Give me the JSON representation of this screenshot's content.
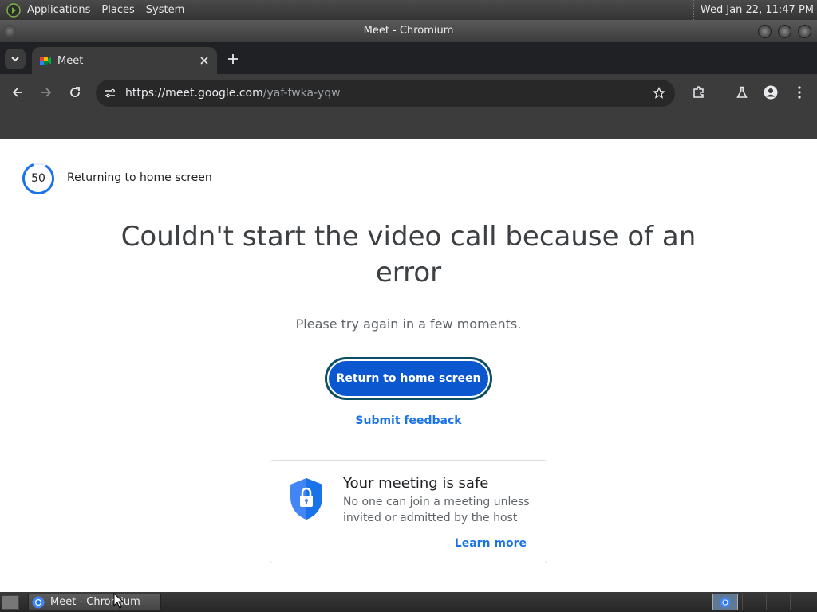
{
  "top_panel": {
    "menus": [
      "Applications",
      "Places",
      "System"
    ],
    "clock": "Wed Jan 22, 11:47 PM"
  },
  "window": {
    "title": "Meet - Chromium"
  },
  "browser": {
    "tab": {
      "title": "Meet",
      "favicon": "google-meet-icon"
    },
    "url": {
      "host": "https://meet.google.com",
      "path": "/yaf-fwka-yqw"
    }
  },
  "page": {
    "countdown_value": "50",
    "countdown_label": "Returning to home screen",
    "headline": "Couldn't start the video call because of an error",
    "subtext": "Please try again in a few moments.",
    "primary_button": "Return to home screen",
    "feedback_link": "Submit feedback",
    "safe_card": {
      "title": "Your meeting is safe",
      "description": "No one can join a meeting unless invited or admitted by the host",
      "link": "Learn more"
    }
  },
  "taskbar": {
    "task_label": "Meet - Chromium"
  },
  "colors": {
    "accent_blue": "#0b57d0",
    "link_blue": "#1a73e8",
    "shield_blue": "#4285f4",
    "chrome_dark": "#3c3c3c"
  }
}
